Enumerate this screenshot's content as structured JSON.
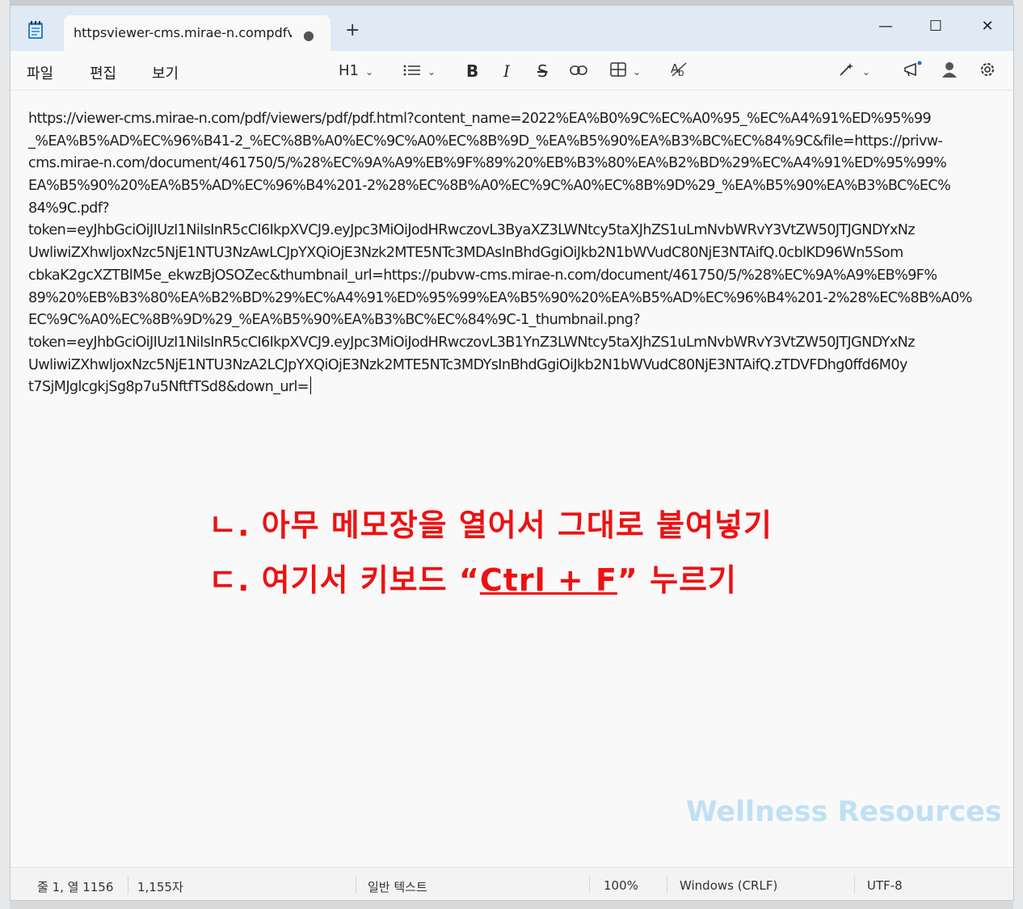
{
  "tab": {
    "title": "httpsviewer-cms.mirae-n.compdfvie",
    "modified_dot": "●",
    "new_tab": "+"
  },
  "window_controls": {
    "minimize": "—",
    "maximize": "☐",
    "close": "✕"
  },
  "menu": {
    "file": "파일",
    "edit": "편집",
    "view": "보기"
  },
  "toolbar": {
    "heading": "H1",
    "bold": "B",
    "italic": "I",
    "strike": "S",
    "link": "🔗",
    "table": "⊞",
    "spell": "A̶"
  },
  "icons": [
    "notepad-icon",
    "heading-icon",
    "list-icon",
    "bold-icon",
    "italic-icon",
    "strikethrough-icon",
    "link-icon",
    "table-icon",
    "spellcheck-icon",
    "copilot-icon",
    "announcement-icon",
    "account-icon",
    "settings-icon"
  ],
  "editor": {
    "lines": [
      "https://viewer-cms.mirae-n.com/pdf/viewers/pdf/pdf.html?content_name=2022%EA%B0%9C%EC%A0%95_%EC%A4%91%ED%95%99",
      "_%EA%B5%AD%EC%96%B41-2_%EC%8B%A0%EC%9C%A0%EC%8B%9D_%EA%B5%90%EA%B3%BC%EC%84%9C&file=https://privw-",
      "cms.mirae-n.com/document/461750/5/%28%EC%9A%A9%EB%9F%89%20%EB%B3%80%EA%B2%BD%29%EC%A4%91%ED%95%99%",
      "EA%B5%90%20%EA%B5%AD%EC%96%B4%201-2%28%EC%8B%A0%EC%9C%A0%EC%8B%9D%29_%EA%B5%90%EA%B3%BC%EC%",
      "84%9C.pdf?",
      "token=eyJhbGciOiJIUzI1NiIsInR5cCI6IkpXVCJ9.eyJpc3MiOiJodHRwczovL3ByaXZ3LWNtcy5taXJhZS1uLmNvbWRvY3VtZW50JTJGNDYxNz",
      "UwliwiZXhwljoxNzc5NjE1NTU3NzAwLCJpYXQiOjE3Nzk2MTE5NTc3MDAsInBhdGgiOiJkb2N1bWVudC80NjE3NTAifQ.0cblKD96Wn5Som",
      "cbkaK2gcXZTBlM5e_ekwzBjOSOZec&thumbnail_url=https://pubvw-cms.mirae-n.com/document/461750/5/%28%EC%9A%A9%EB%9F%",
      "89%20%EB%B3%80%EA%B2%BD%29%EC%A4%91%ED%95%99%EA%B5%90%20%EA%B5%AD%EC%96%B4%201-2%28%EC%8B%A0%",
      "EC%9C%A0%EC%8B%9D%29_%EA%B5%90%EA%B3%BC%EC%84%9C-1_thumbnail.png?",
      "token=eyJhbGciOiJIUzI1NiIsInR5cCI6IkpXVCJ9.eyJpc3MiOiJodHRwczovL3B1YnZ3LWNtcy5taXJhZS1uLmNvbWRvY3VtZW50JTJGNDYxNz",
      "UwliwiZXhwljoxNzc5NjE1NTU3NzA2LCJpYXQiOjE3Nzk2MTE5NTc3MDYsInBhdGgiOiJkb2N1bWVudC80NjE3NTAifQ.zTDVFDhg0ffd6M0y",
      "t7SjMJglcgkjSg8p7u5NftfTSd8&down_url="
    ]
  },
  "annotation": {
    "line1": "ㄴ. 아무 메모장을 열어서 그대로 붙여넣기",
    "line2_prefix": "ㄷ. 여기서 키보드 “",
    "line2_shortcut": "Ctrl + F",
    "line2_suffix": "” 누르기"
  },
  "watermark": "Wellness Resources",
  "status": {
    "position": "줄 1, 열 1156",
    "char_count": "1,155자",
    "format": "일반 텍스트",
    "zoom": "100%",
    "line_ending": "Windows (CRLF)",
    "encoding": "UTF-8"
  }
}
